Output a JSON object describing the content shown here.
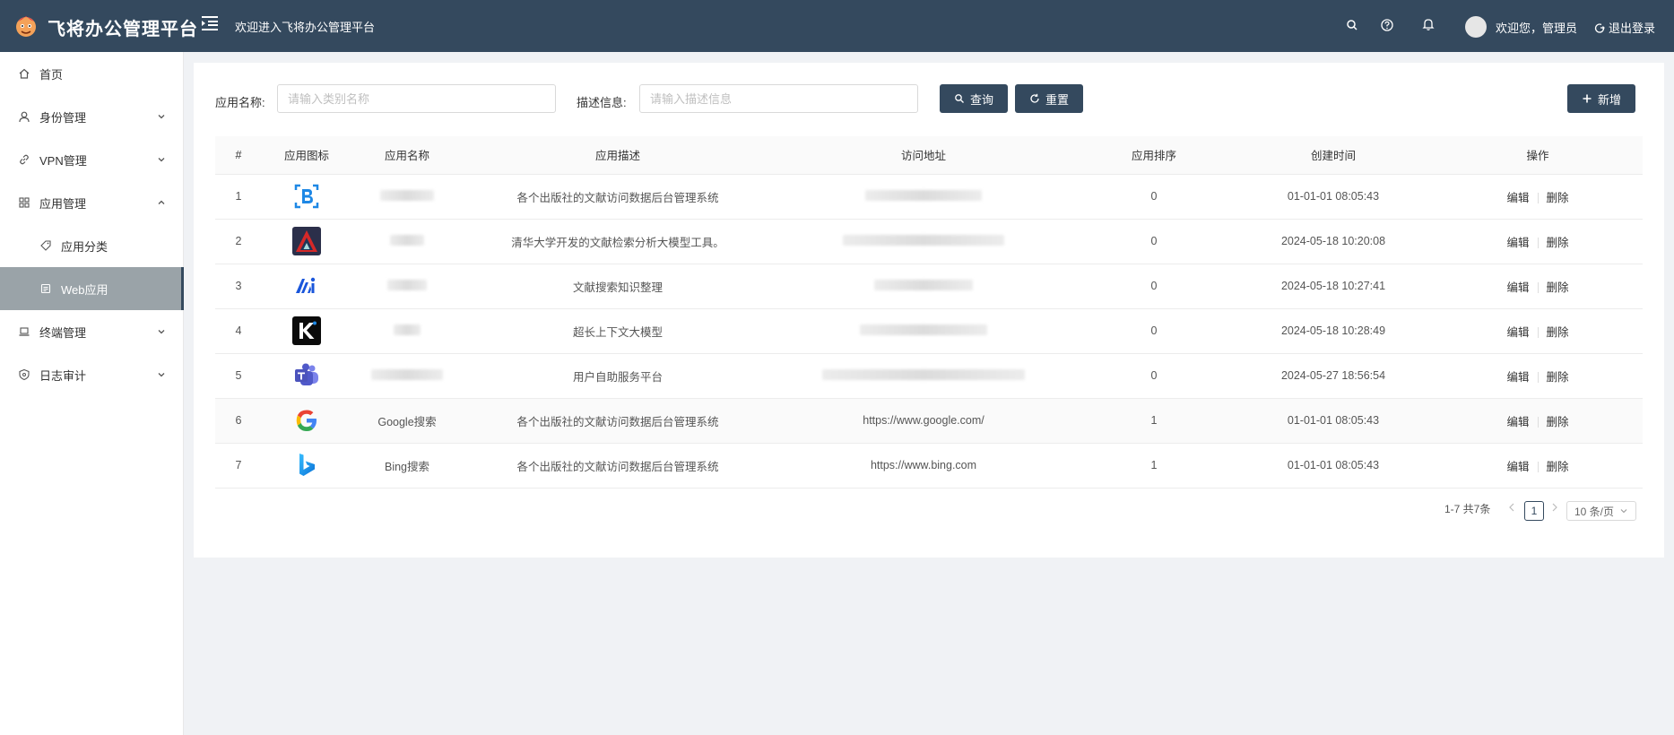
{
  "header": {
    "app_title": "飞将办公管理平台",
    "welcome": "欢迎进入飞将办公管理平台",
    "user_greeting": "欢迎您，管理员",
    "logout": "退出登录",
    "background": "#34495e"
  },
  "sidebar": {
    "items": [
      {
        "label": "首页",
        "icon": "home-icon"
      },
      {
        "label": "身份管理",
        "icon": "user-icon"
      },
      {
        "label": "VPN管理",
        "icon": "link-icon"
      },
      {
        "label": "应用管理",
        "icon": "grid-icon"
      },
      {
        "label": "应用分类",
        "icon": "tag-icon"
      },
      {
        "label": "Web应用",
        "icon": "web-icon"
      },
      {
        "label": "终端管理",
        "icon": "laptop-icon"
      },
      {
        "label": "日志审计",
        "icon": "shield-icon"
      }
    ],
    "active": "Web应用"
  },
  "filters": {
    "app_name_label": "应用名称:",
    "app_name_placeholder": "请输入类别名称",
    "desc_label": "描述信息:",
    "desc_placeholder": "请输入描述信息",
    "query": "查询",
    "reset": "重置",
    "add": "新增"
  },
  "table": {
    "columns": [
      "#",
      "应用图标",
      "应用名称",
      "应用描述",
      "访问地址",
      "应用排序",
      "创建时间",
      "操作"
    ],
    "rows": [
      {
        "num": "1",
        "icon": "b-icon",
        "name": "",
        "desc": "各个出版社的文献访问数据后台管理系统",
        "url": "",
        "order": "0",
        "created": "01-01-01 08:05:43"
      },
      {
        "num": "2",
        "icon": "triangle-app-icon",
        "name": "",
        "desc": "清华大学开发的文献检索分析大模型工具。",
        "url": "",
        "order": "0",
        "created": "2024-05-18 10:20:08"
      },
      {
        "num": "3",
        "icon": "ai-app-icon",
        "name": "",
        "desc": "文献搜索知识整理",
        "url": "",
        "order": "0",
        "created": "2024-05-18 10:27:41"
      },
      {
        "num": "4",
        "icon": "k-app-icon",
        "name": "",
        "desc": "超长上下文大模型",
        "url": "",
        "order": "0",
        "created": "2024-05-18 10:28:49"
      },
      {
        "num": "5",
        "icon": "teams-icon",
        "name": "",
        "desc": "用户自助服务平台",
        "url": "",
        "order": "0",
        "created": "2024-05-27 18:56:54"
      },
      {
        "num": "6",
        "icon": "google-icon",
        "name": "Google搜索",
        "desc": "各个出版社的文献访问数据后台管理系统",
        "url": "https://www.google.com/",
        "order": "1",
        "created": "01-01-01 08:05:43"
      },
      {
        "num": "7",
        "icon": "bing-icon",
        "name": "Bing搜索",
        "desc": "各个出版社的文献访问数据后台管理系统",
        "url": "https://www.bing.com",
        "order": "1",
        "created": "01-01-01 08:05:43"
      }
    ],
    "edit": "编辑",
    "delete": "删除"
  },
  "pagination": {
    "summary": "1-7 共7条",
    "current": "1",
    "page_size": "10 条/页"
  }
}
